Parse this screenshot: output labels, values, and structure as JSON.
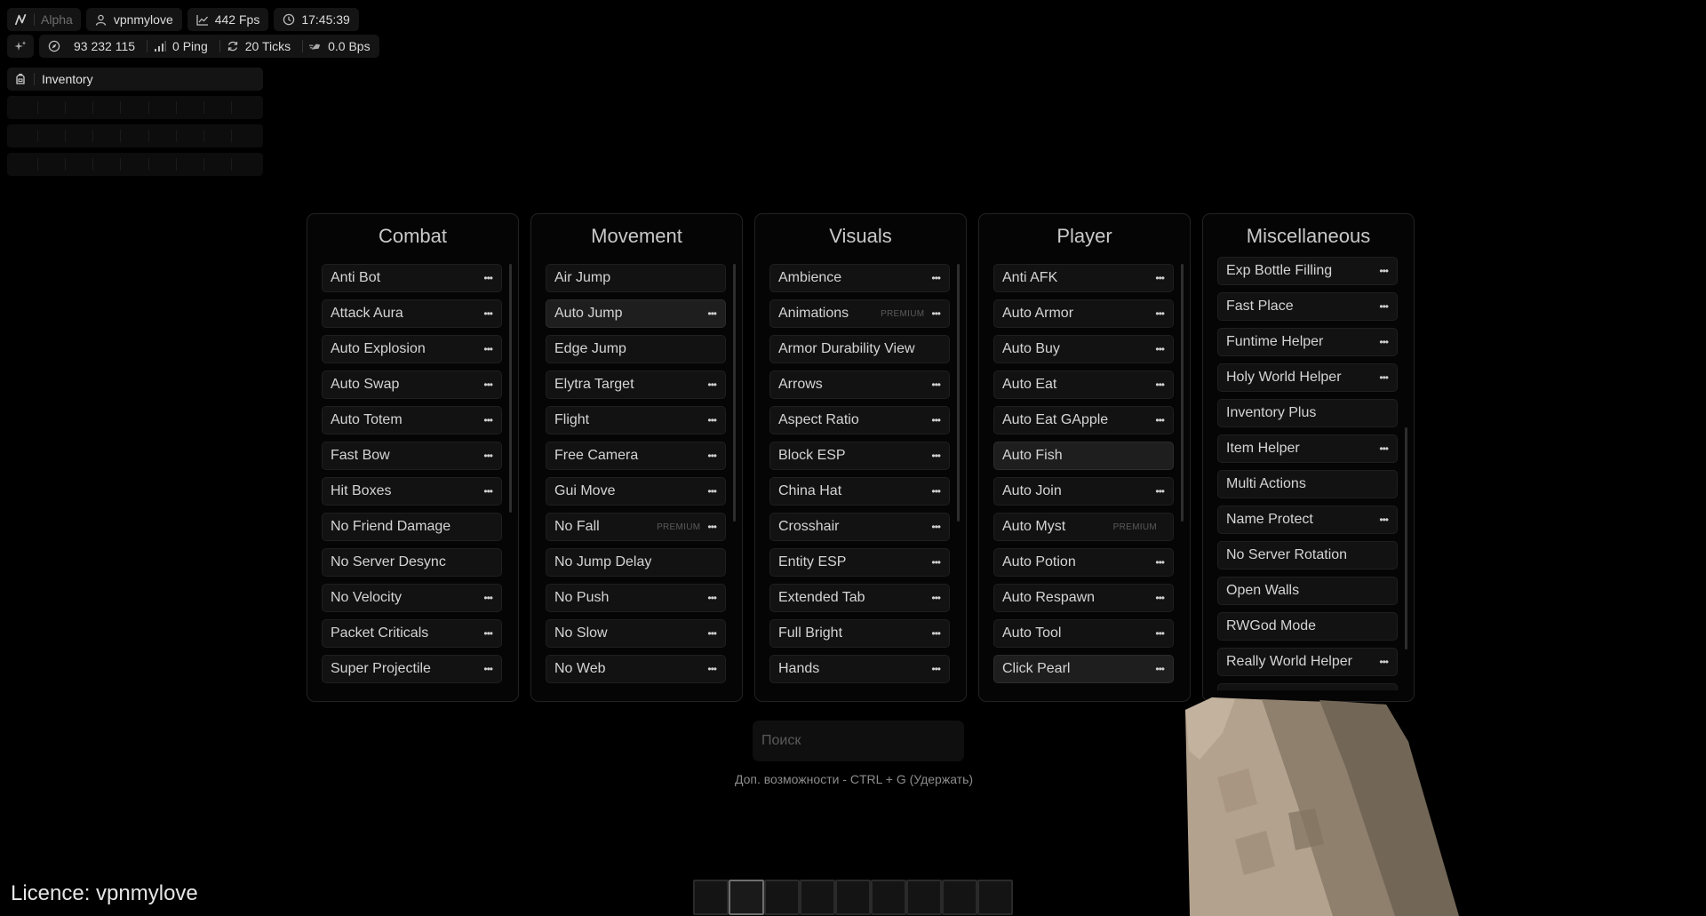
{
  "hud": {
    "brand": "Alpha",
    "username": "vpnmylove",
    "fps": "442 Fps",
    "time": "17:45:39",
    "coords": "93 232 115",
    "ping": "0 Ping",
    "ticks": "20 Ticks",
    "bps": "0.0 Bps"
  },
  "inventory": {
    "title": "Inventory"
  },
  "panels": [
    {
      "title": "Combat",
      "modules": [
        {
          "name": "Anti Bot",
          "settings": true
        },
        {
          "name": "Attack Aura",
          "settings": true
        },
        {
          "name": "Auto Explosion",
          "settings": true
        },
        {
          "name": "Auto Swap",
          "settings": true
        },
        {
          "name": "Auto Totem",
          "settings": true
        },
        {
          "name": "Fast Bow",
          "settings": true
        },
        {
          "name": "Hit Boxes",
          "settings": true
        },
        {
          "name": "No Friend Damage",
          "settings": false
        },
        {
          "name": "No Server Desync",
          "settings": false
        },
        {
          "name": "No Velocity",
          "settings": true
        },
        {
          "name": "Packet Criticals",
          "settings": true
        },
        {
          "name": "Super Projectile",
          "settings": true
        }
      ]
    },
    {
      "title": "Movement",
      "modules": [
        {
          "name": "Air Jump",
          "settings": false
        },
        {
          "name": "Auto Jump",
          "settings": true,
          "enabled": true
        },
        {
          "name": "Edge Jump",
          "settings": false
        },
        {
          "name": "Elytra Target",
          "settings": true
        },
        {
          "name": "Flight",
          "settings": true
        },
        {
          "name": "Free Camera",
          "settings": true
        },
        {
          "name": "Gui Move",
          "settings": true
        },
        {
          "name": "No Fall",
          "settings": true,
          "badge": "PREMIUM"
        },
        {
          "name": "No Jump Delay",
          "settings": false
        },
        {
          "name": "No Push",
          "settings": true
        },
        {
          "name": "No Slow",
          "settings": true
        },
        {
          "name": "No Web",
          "settings": true
        }
      ]
    },
    {
      "title": "Visuals",
      "modules": [
        {
          "name": "Ambience",
          "settings": true
        },
        {
          "name": "Animations",
          "settings": true,
          "badge": "PREMIUM"
        },
        {
          "name": "Armor Durability View",
          "settings": false
        },
        {
          "name": "Arrows",
          "settings": true
        },
        {
          "name": "Aspect Ratio",
          "settings": true
        },
        {
          "name": "Block ESP",
          "settings": true
        },
        {
          "name": "China Hat",
          "settings": true
        },
        {
          "name": "Crosshair",
          "settings": true
        },
        {
          "name": "Entity ESP",
          "settings": true
        },
        {
          "name": "Extended Tab",
          "settings": true
        },
        {
          "name": "Full Bright",
          "settings": true
        },
        {
          "name": "Hands",
          "settings": true
        }
      ]
    },
    {
      "title": "Player",
      "modules": [
        {
          "name": "Anti AFK",
          "settings": true
        },
        {
          "name": "Auto Armor",
          "settings": true
        },
        {
          "name": "Auto Buy",
          "settings": true
        },
        {
          "name": "Auto Eat",
          "settings": true
        },
        {
          "name": "Auto Eat GApple",
          "settings": true
        },
        {
          "name": "Auto Fish",
          "settings": false,
          "enabled": true
        },
        {
          "name": "Auto Join",
          "settings": true
        },
        {
          "name": "Auto Myst",
          "settings": false,
          "badge": "PREMIUM"
        },
        {
          "name": "Auto Potion",
          "settings": true
        },
        {
          "name": "Auto Respawn",
          "settings": true
        },
        {
          "name": "Auto Tool",
          "settings": true
        },
        {
          "name": "Click Pearl",
          "settings": true,
          "enabled": true
        }
      ]
    },
    {
      "title": "Miscellaneous",
      "modules": [
        {
          "name": "Exp Bottle Filling",
          "settings": true
        },
        {
          "name": "Fast Place",
          "settings": true
        },
        {
          "name": "Funtime Helper",
          "settings": true
        },
        {
          "name": "Holy World Helper",
          "settings": true
        },
        {
          "name": "Inventory Plus",
          "settings": false
        },
        {
          "name": "Item Helper",
          "settings": true
        },
        {
          "name": "Multi Actions",
          "settings": false
        },
        {
          "name": "Name Protect",
          "settings": true
        },
        {
          "name": "No Server Rotation",
          "settings": false
        },
        {
          "name": "Open Walls",
          "settings": false
        },
        {
          "name": "RWGod Mode",
          "settings": false
        },
        {
          "name": "Really World Helper",
          "settings": true
        }
      ]
    }
  ],
  "search": {
    "placeholder": "Поиск"
  },
  "hint": "Доп. возможности - CTRL + G (Удержать)",
  "licence": "Licence: vpnmylove",
  "hotbar": {
    "slots": 9,
    "selected": 2
  }
}
